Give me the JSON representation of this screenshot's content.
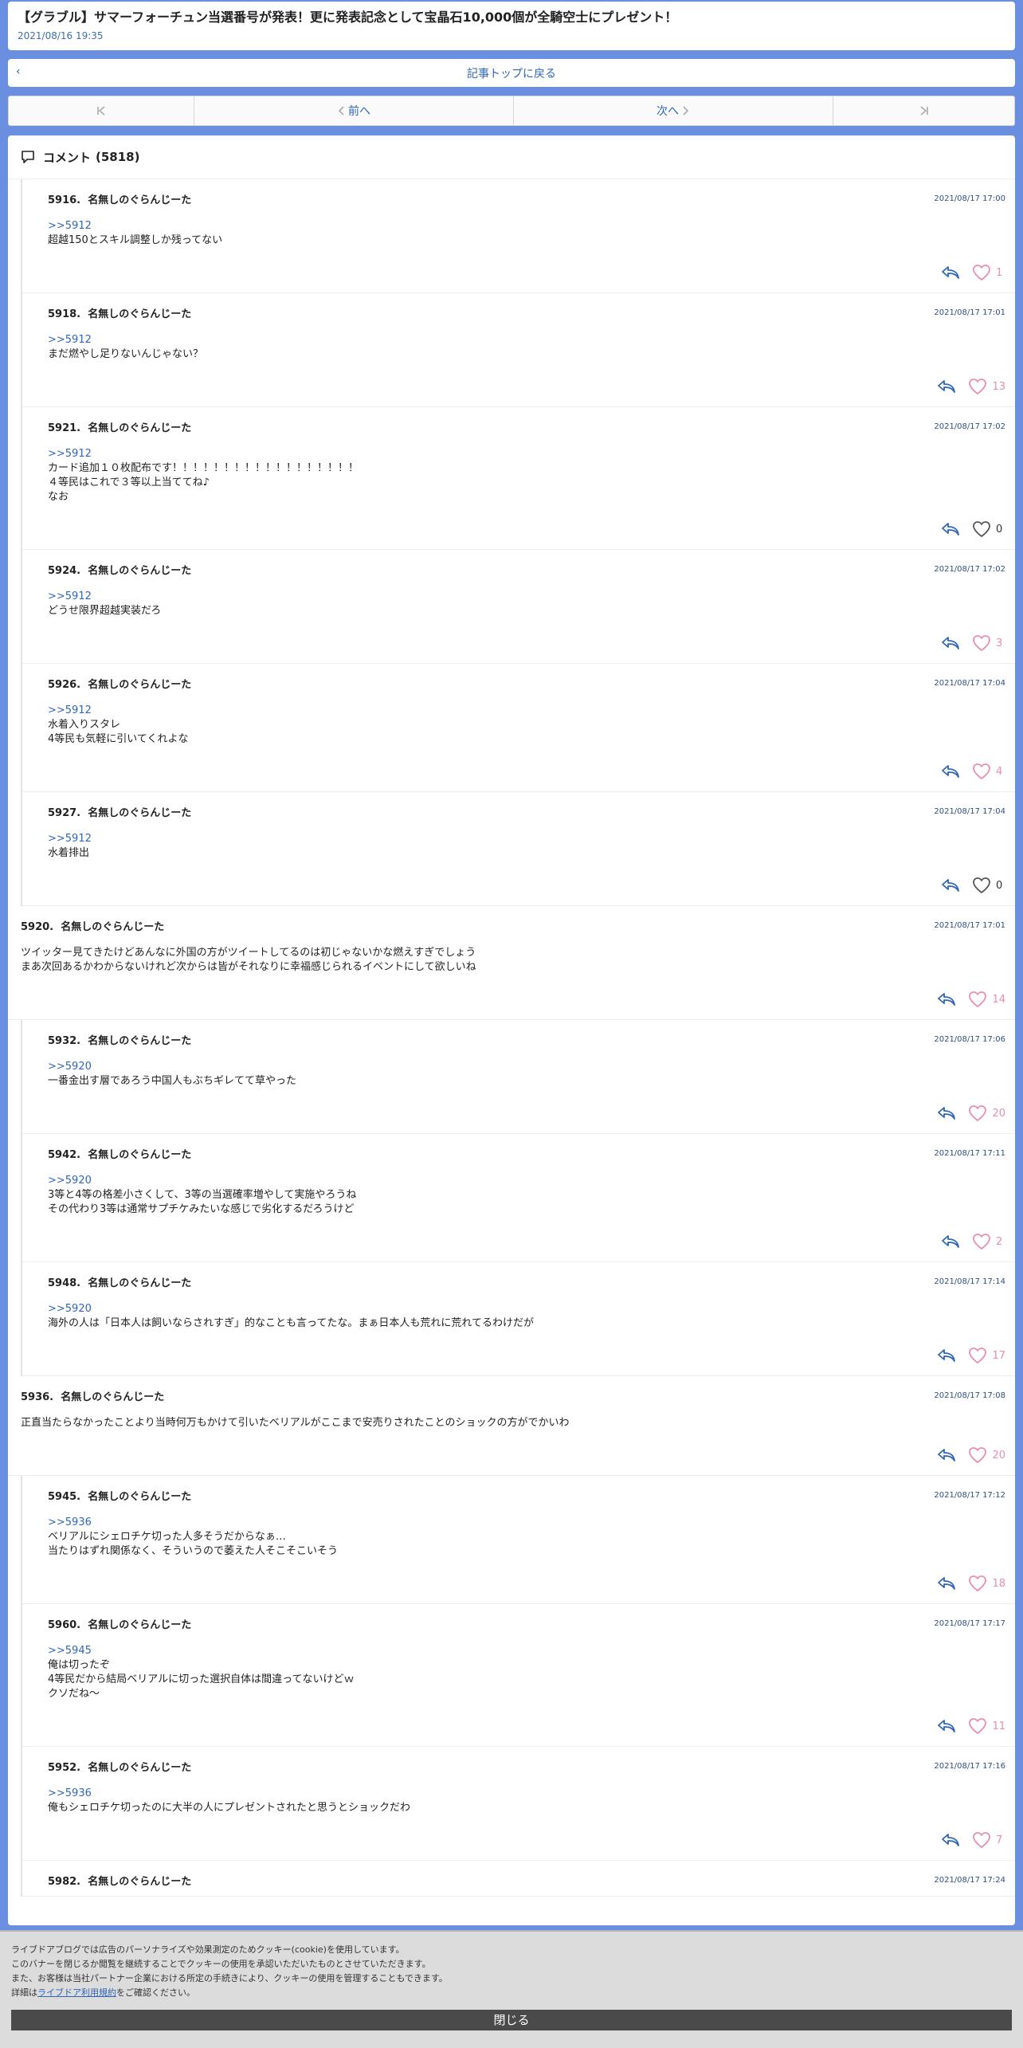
{
  "article": {
    "title": "【グラブル】サマーフォーチュン当選番号が発表！更に発表記念として宝晶石10,000個が全騎空士にプレゼント！",
    "date": "2021/08/16 19:35"
  },
  "back_label": "記事トップに戻る",
  "pager": {
    "prev_label": "前へ",
    "next_label": "次へ"
  },
  "comments_header": {
    "label": "コメント",
    "count": "(5818)"
  },
  "comments": [
    {
      "level": "reply",
      "num": "5916.",
      "name": "名無しのぐらんじーた",
      "time": "2021/08/17 17:00",
      "anchor": ">>5912",
      "lines": [
        "超越150とスキル調整しか残ってない"
      ],
      "likes": "1"
    },
    {
      "level": "reply",
      "num": "5918.",
      "name": "名無しのぐらんじーた",
      "time": "2021/08/17 17:01",
      "anchor": ">>5912",
      "lines": [
        "まだ燃やし足りないんじゃない？"
      ],
      "likes": "13"
    },
    {
      "level": "reply",
      "num": "5921.",
      "name": "名無しのぐらんじーた",
      "time": "2021/08/17 17:02",
      "anchor": ">>5912",
      "lines": [
        "カード追加１０枚配布です！！！！！！！！！！！！！！！！！！",
        "４等民はこれで３等以上当ててね♪",
        "なお"
      ],
      "likes": "0"
    },
    {
      "level": "reply",
      "num": "5924.",
      "name": "名無しのぐらんじーた",
      "time": "2021/08/17 17:02",
      "anchor": ">>5912",
      "lines": [
        "どうせ限界超越実装だろ"
      ],
      "likes": "3"
    },
    {
      "level": "reply",
      "num": "5926.",
      "name": "名無しのぐらんじーた",
      "time": "2021/08/17 17:04",
      "anchor": ">>5912",
      "lines": [
        "水着入りスタレ",
        "4等民も気軽に引いてくれよな"
      ],
      "likes": "4"
    },
    {
      "level": "reply",
      "num": "5927.",
      "name": "名無しのぐらんじーた",
      "time": "2021/08/17 17:04",
      "anchor": ">>5912",
      "lines": [
        "水着排出"
      ],
      "likes": "0"
    },
    {
      "level": "top",
      "num": "5920.",
      "name": "名無しのぐらんじーた",
      "time": "2021/08/17 17:01",
      "anchor": "",
      "lines": [
        "ツイッター見てきたけどあんなに外国の方がツイートしてるのは初じゃないかな燃えすぎでしょう",
        "まあ次回あるかわからないけれど次からは皆がそれなりに幸福感じられるイベントにして欲しいね"
      ],
      "likes": "14"
    },
    {
      "level": "reply",
      "num": "5932.",
      "name": "名無しのぐらんじーた",
      "time": "2021/08/17 17:06",
      "anchor": ">>5920",
      "lines": [
        "一番金出す層であろう中国人もぶちギレてて草やった"
      ],
      "likes": "20"
    },
    {
      "level": "reply",
      "num": "5942.",
      "name": "名無しのぐらんじーた",
      "time": "2021/08/17 17:11",
      "anchor": ">>5920",
      "lines": [
        "3等と4等の格差小さくして、3等の当選確率増やして実施やろうね",
        "その代わり3等は通常サプチケみたいな感じで劣化するだろうけど"
      ],
      "likes": "2"
    },
    {
      "level": "reply",
      "num": "5948.",
      "name": "名無しのぐらんじーた",
      "time": "2021/08/17 17:14",
      "anchor": ">>5920",
      "lines": [
        "海外の人は「日本人は飼いならされすぎ」的なことも言ってたな。まぁ日本人も荒れに荒れてるわけだが"
      ],
      "likes": "17"
    },
    {
      "level": "top",
      "num": "5936.",
      "name": "名無しのぐらんじーた",
      "time": "2021/08/17 17:08",
      "anchor": "",
      "lines": [
        "正直当たらなかったことより当時何万もかけて引いたベリアルがここまで安売りされたことのショックの方がでかいわ"
      ],
      "likes": "20"
    },
    {
      "level": "reply",
      "num": "5945.",
      "name": "名無しのぐらんじーた",
      "time": "2021/08/17 17:12",
      "anchor": ">>5936",
      "lines": [
        "ベリアルにシェロチケ切った人多そうだからなぁ…",
        "当たりはずれ関係なく、そういうので萎えた人そこそこいそう"
      ],
      "likes": "18"
    },
    {
      "level": "reply",
      "num": "5960.",
      "name": "名無しのぐらんじーた",
      "time": "2021/08/17 17:17",
      "anchor": ">>5945",
      "lines": [
        "俺は切ったぞ",
        "4等民だから結局ベリアルに切った選択自体は間違ってないけどｗ",
        "クソだね～"
      ],
      "likes": "11"
    },
    {
      "level": "reply",
      "num": "5952.",
      "name": "名無しのぐらんじーた",
      "time": "2021/08/17 17:16",
      "anchor": ">>5936",
      "lines": [
        "俺もシェロチケ切ったのに大半の人にプレゼントされたと思うとショックだわ"
      ],
      "likes": "7"
    },
    {
      "level": "reply",
      "num": "5982.",
      "name": "名無しのぐらんじーた",
      "time": "2021/08/17 17:24",
      "anchor": "",
      "lines": [],
      "likes": ""
    }
  ],
  "cookie_banner": {
    "line1": "ライブドアブログでは広告のパーソナライズや効果測定のためクッキー(cookie)を使用しています。",
    "line2": "このバナーを閉じるか閲覧を継続することでクッキーの使用を承認いただいたものとさせていただきます。",
    "line3": "また、お客様は当社パートナー企業における所定の手続きにより、クッキーの使用を管理することもできます。",
    "line4_prefix": "詳細は",
    "link": "ライブドア利用規約",
    "line4_suffix": "をご確認ください。",
    "close_label": "閉じる"
  },
  "colors": {
    "background": "#6a8ee0",
    "link": "#2f66b5",
    "like": "#e88fa9"
  }
}
